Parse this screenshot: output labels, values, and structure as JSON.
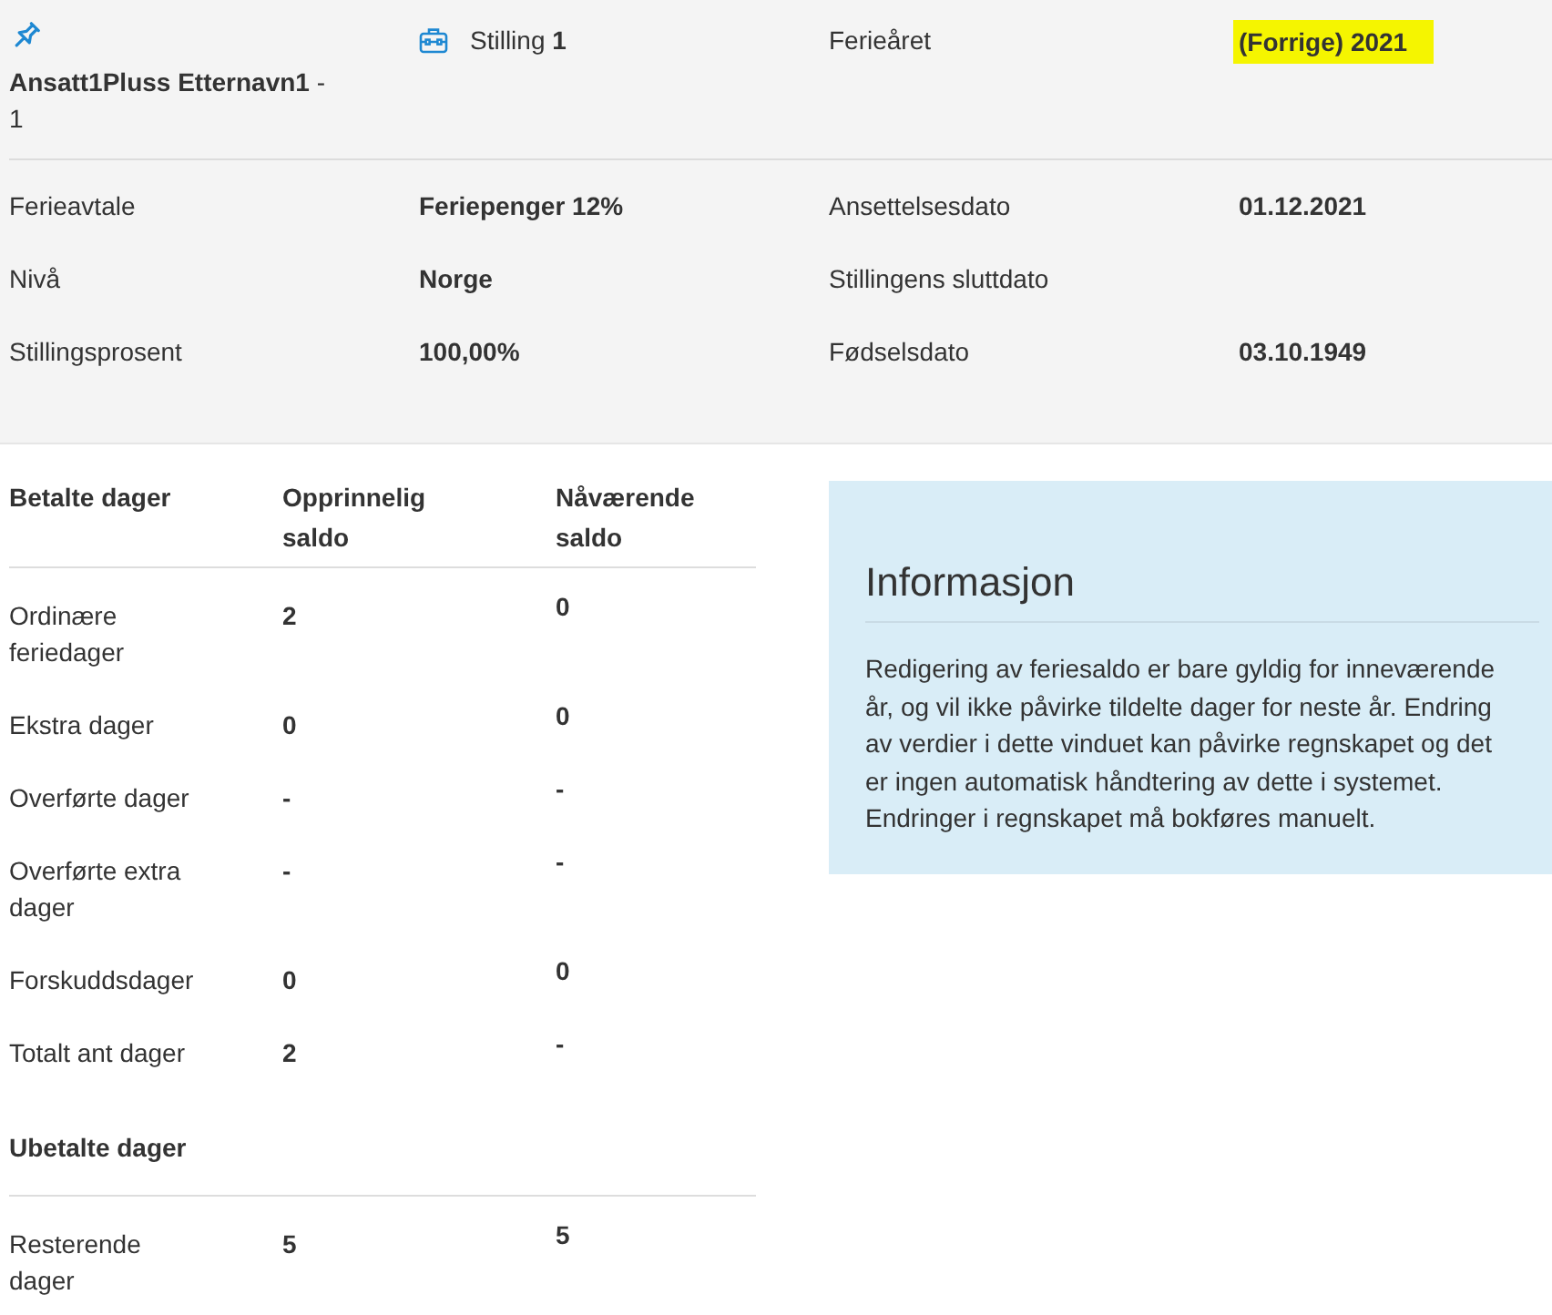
{
  "header": {
    "employee": {
      "name": "**Ansatt1Pluss Etternavn1** - 1"
    },
    "position": {
      "text": "Stilling **1**"
    },
    "holiday_year": {
      "label": "Ferieåret",
      "value": "(Forrige) 2021",
      "highlighted": true
    }
  },
  "details": [
    {
      "label": "Ferieavtale",
      "value": "Feriepenger 12%"
    },
    {
      "label": "Ansettelsesdato",
      "value": "01.12.2021"
    },
    {
      "label": "Nivå",
      "value": "Norge"
    },
    {
      "label": "Stillingens sluttdato"
    },
    {
      "label": "Stillingsprosent",
      "value": "100,00%"
    },
    {
      "label": "Fødselsdato",
      "value": "03.10.1949"
    }
  ],
  "balance_sections": [
    {
      "header": [
        "Betalte dager",
        "Opprinnelig saldo",
        "Nåværende saldo"
      ],
      "rows": [
        {
          "label": "Ordinære feriedager",
          "original": "2",
          "current": "0"
        },
        {
          "label": "Ekstra dager",
          "original": "0",
          "current": "0"
        },
        {
          "label": "Overførte dager",
          "original": "-",
          "current": "-"
        },
        {
          "label": "Overførte extra dager",
          "original": "-",
          "current": "-"
        },
        {
          "label": "Forskuddsdager",
          "original": "0",
          "current": "0"
        },
        {
          "label": "Totalt ant dager",
          "original": "2",
          "current": "-"
        }
      ]
    },
    {
      "header": [
        "Ubetalte dager"
      ],
      "rows": [
        {
          "label": "Resterende dager",
          "original": "5",
          "current": "5"
        }
      ]
    }
  ],
  "info_box": {
    "title": "Informasjon",
    "text": "Redigering av feriesaldo er bare gyldig for inneværende år, og vil ikke påvirke tildelte dager for neste år. Endring av verdier i dette vinduet kan påvirke regnskapet og det er ingen automatisk håndtering av dette i systemet. Endringer i regnskapet må bokføres manuelt."
  }
}
